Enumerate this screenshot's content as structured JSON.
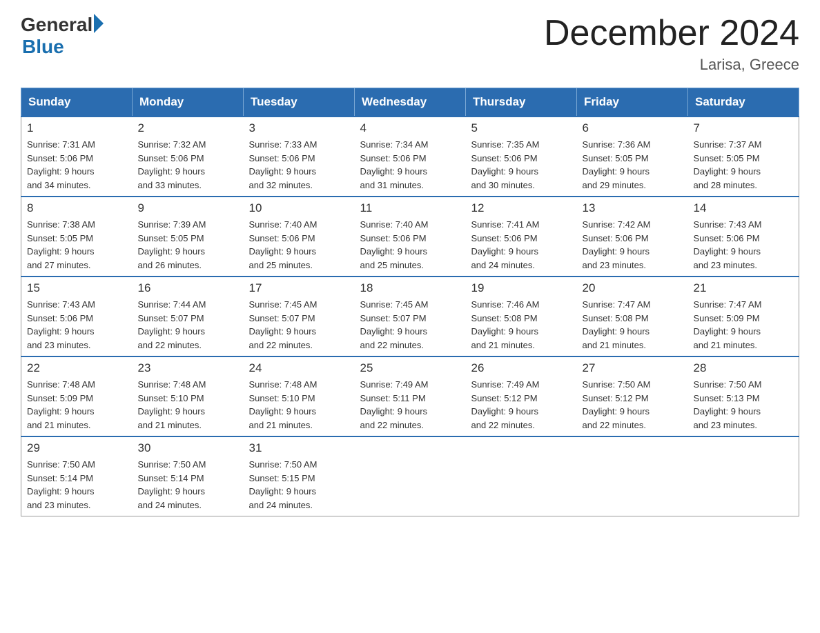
{
  "logo": {
    "general": "General",
    "blue": "Blue"
  },
  "title": "December 2024",
  "location": "Larisa, Greece",
  "days_of_week": [
    "Sunday",
    "Monday",
    "Tuesday",
    "Wednesday",
    "Thursday",
    "Friday",
    "Saturday"
  ],
  "weeks": [
    [
      {
        "day": "1",
        "sunrise": "7:31 AM",
        "sunset": "5:06 PM",
        "daylight": "9 hours and 34 minutes."
      },
      {
        "day": "2",
        "sunrise": "7:32 AM",
        "sunset": "5:06 PM",
        "daylight": "9 hours and 33 minutes."
      },
      {
        "day": "3",
        "sunrise": "7:33 AM",
        "sunset": "5:06 PM",
        "daylight": "9 hours and 32 minutes."
      },
      {
        "day": "4",
        "sunrise": "7:34 AM",
        "sunset": "5:06 PM",
        "daylight": "9 hours and 31 minutes."
      },
      {
        "day": "5",
        "sunrise": "7:35 AM",
        "sunset": "5:06 PM",
        "daylight": "9 hours and 30 minutes."
      },
      {
        "day": "6",
        "sunrise": "7:36 AM",
        "sunset": "5:05 PM",
        "daylight": "9 hours and 29 minutes."
      },
      {
        "day": "7",
        "sunrise": "7:37 AM",
        "sunset": "5:05 PM",
        "daylight": "9 hours and 28 minutes."
      }
    ],
    [
      {
        "day": "8",
        "sunrise": "7:38 AM",
        "sunset": "5:05 PM",
        "daylight": "9 hours and 27 minutes."
      },
      {
        "day": "9",
        "sunrise": "7:39 AM",
        "sunset": "5:05 PM",
        "daylight": "9 hours and 26 minutes."
      },
      {
        "day": "10",
        "sunrise": "7:40 AM",
        "sunset": "5:06 PM",
        "daylight": "9 hours and 25 minutes."
      },
      {
        "day": "11",
        "sunrise": "7:40 AM",
        "sunset": "5:06 PM",
        "daylight": "9 hours and 25 minutes."
      },
      {
        "day": "12",
        "sunrise": "7:41 AM",
        "sunset": "5:06 PM",
        "daylight": "9 hours and 24 minutes."
      },
      {
        "day": "13",
        "sunrise": "7:42 AM",
        "sunset": "5:06 PM",
        "daylight": "9 hours and 23 minutes."
      },
      {
        "day": "14",
        "sunrise": "7:43 AM",
        "sunset": "5:06 PM",
        "daylight": "9 hours and 23 minutes."
      }
    ],
    [
      {
        "day": "15",
        "sunrise": "7:43 AM",
        "sunset": "5:06 PM",
        "daylight": "9 hours and 23 minutes."
      },
      {
        "day": "16",
        "sunrise": "7:44 AM",
        "sunset": "5:07 PM",
        "daylight": "9 hours and 22 minutes."
      },
      {
        "day": "17",
        "sunrise": "7:45 AM",
        "sunset": "5:07 PM",
        "daylight": "9 hours and 22 minutes."
      },
      {
        "day": "18",
        "sunrise": "7:45 AM",
        "sunset": "5:07 PM",
        "daylight": "9 hours and 22 minutes."
      },
      {
        "day": "19",
        "sunrise": "7:46 AM",
        "sunset": "5:08 PM",
        "daylight": "9 hours and 21 minutes."
      },
      {
        "day": "20",
        "sunrise": "7:47 AM",
        "sunset": "5:08 PM",
        "daylight": "9 hours and 21 minutes."
      },
      {
        "day": "21",
        "sunrise": "7:47 AM",
        "sunset": "5:09 PM",
        "daylight": "9 hours and 21 minutes."
      }
    ],
    [
      {
        "day": "22",
        "sunrise": "7:48 AM",
        "sunset": "5:09 PM",
        "daylight": "9 hours and 21 minutes."
      },
      {
        "day": "23",
        "sunrise": "7:48 AM",
        "sunset": "5:10 PM",
        "daylight": "9 hours and 21 minutes."
      },
      {
        "day": "24",
        "sunrise": "7:48 AM",
        "sunset": "5:10 PM",
        "daylight": "9 hours and 21 minutes."
      },
      {
        "day": "25",
        "sunrise": "7:49 AM",
        "sunset": "5:11 PM",
        "daylight": "9 hours and 22 minutes."
      },
      {
        "day": "26",
        "sunrise": "7:49 AM",
        "sunset": "5:12 PM",
        "daylight": "9 hours and 22 minutes."
      },
      {
        "day": "27",
        "sunrise": "7:50 AM",
        "sunset": "5:12 PM",
        "daylight": "9 hours and 22 minutes."
      },
      {
        "day": "28",
        "sunrise": "7:50 AM",
        "sunset": "5:13 PM",
        "daylight": "9 hours and 23 minutes."
      }
    ],
    [
      {
        "day": "29",
        "sunrise": "7:50 AM",
        "sunset": "5:14 PM",
        "daylight": "9 hours and 23 minutes."
      },
      {
        "day": "30",
        "sunrise": "7:50 AM",
        "sunset": "5:14 PM",
        "daylight": "9 hours and 24 minutes."
      },
      {
        "day": "31",
        "sunrise": "7:50 AM",
        "sunset": "5:15 PM",
        "daylight": "9 hours and 24 minutes."
      },
      null,
      null,
      null,
      null
    ]
  ]
}
